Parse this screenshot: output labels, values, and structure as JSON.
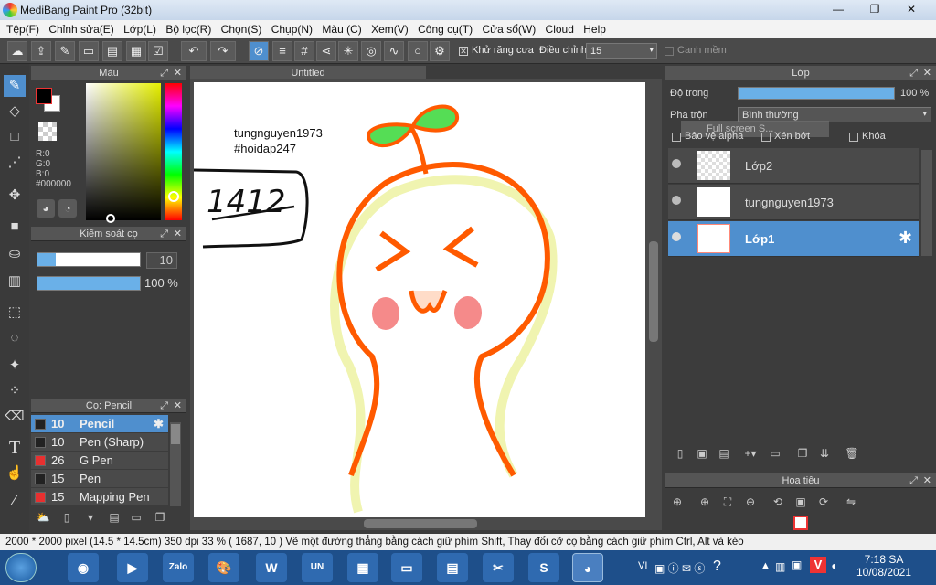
{
  "window": {
    "title": "MediBang Paint Pro (32bit)",
    "controls": [
      "—",
      "❐",
      "✕"
    ]
  },
  "menu": [
    "Tệp(F)",
    "Chỉnh sửa(E)",
    "Lớp(L)",
    "Bộ lọc(R)",
    "Chọn(S)",
    "Chụp(N)",
    "Màu (C)",
    "Xem(V)",
    "Công cụ(T)",
    "Cửa sổ(W)",
    "Cloud",
    "Help"
  ],
  "toolbar": {
    "antialias_label": "Khử răng cưa",
    "adjust_label": "Điều chỉnh",
    "adjust_value": "15",
    "smooth_label": "Canh mềm"
  },
  "color_panel": {
    "title": "Màu",
    "r": "R:0",
    "g": "G:0",
    "b": "B:0",
    "hex": "#000000",
    "fg": "#000000",
    "bg": "#ffffff"
  },
  "brush_control": {
    "title": "Kiểm soát cọ",
    "size": "10",
    "opacity": "100 %",
    "size_fraction": 0.18,
    "opacity_fraction": 1.0
  },
  "brush_panel": {
    "title": "Cọ: Pencil",
    "items": [
      {
        "size": "10",
        "name": "Pencil",
        "color": "#222222",
        "selected": true
      },
      {
        "size": "10",
        "name": "Pen (Sharp)",
        "color": "#222222",
        "selected": false
      },
      {
        "size": "26",
        "name": "G Pen",
        "color": "#e83030",
        "selected": false
      },
      {
        "size": "15",
        "name": "Pen",
        "color": "#222222",
        "selected": false
      },
      {
        "size": "15",
        "name": "Mapping Pen",
        "color": "#e83030",
        "selected": false
      }
    ]
  },
  "canvas": {
    "tab": "Untitled",
    "text_line1": "tungnguyen1973",
    "text_line2": "#hoidap247",
    "scribble": "1412"
  },
  "layer_panel": {
    "title": "Lớp",
    "opacity_label": "Độ trong",
    "opacity_value": "100 %",
    "opacity_fraction": 1.0,
    "blend_label": "Pha trộn",
    "blend_value": "Bình thường",
    "tooltip": "Full screen S...",
    "protect_alpha": "Bảo vệ alpha",
    "clipping": "Xén bớt",
    "lock": "Khóa",
    "layers": [
      {
        "name": "Lớp2",
        "selected": false
      },
      {
        "name": "tungnguyen1973",
        "selected": false
      },
      {
        "name": "Lớp1",
        "selected": true
      }
    ]
  },
  "navigator": {
    "title": "Hoa tiêu"
  },
  "status": {
    "text": "2000 * 2000 pixel   (14.5 * 14.5cm)   350 dpi   33 %   ( 1687, 10 )   Vẽ một đường thẳng bằng cách giữ phím Shift, Thay đổi cỡ cọ bằng cách giữ phím Ctrl, Alt và kéo"
  },
  "taskbar": {
    "time": "7:18 SA",
    "date": "10/08/2021",
    "lang": "VI"
  }
}
